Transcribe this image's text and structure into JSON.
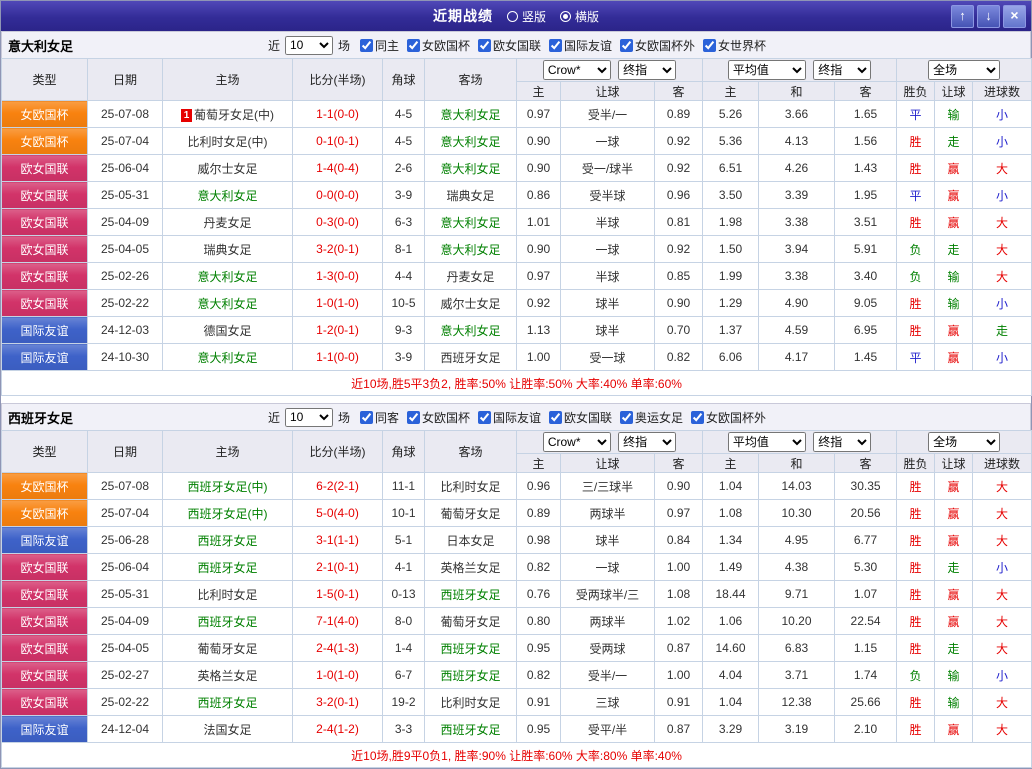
{
  "titlebar": {
    "title": "近期战绩",
    "radios": [
      {
        "label": "竖版",
        "checked": false
      },
      {
        "label": "横版",
        "checked": true
      }
    ],
    "up_icon": "↑",
    "down_icon": "↓",
    "close_icon": "×"
  },
  "filter_labels": {
    "near": "近",
    "games_suffix": "场"
  },
  "header": {
    "col_type": "类型",
    "col_date": "日期",
    "col_home": "主场",
    "col_score": "比分(半场)",
    "col_corner": "角球",
    "col_away": "客场",
    "bookmaker_select": "Crow*",
    "index_select_1": "终指",
    "avg_select": "平均值",
    "index_select_2": "终指",
    "scope_select": "全场",
    "sub_cols": [
      "主",
      "让球",
      "客",
      "主",
      "和",
      "客",
      "胜负",
      "让球",
      "进球数"
    ]
  },
  "colors": {
    "type_badges": {
      "女欧国杯": "#f8820f",
      "欧女国联": "#d23369",
      "国际友谊": "#3e62c9"
    },
    "team_focus": "#008000",
    "team_normal": "#333333",
    "score": "#e60000",
    "red_card_badge": "#e60000",
    "results": {
      "胜": "#e60000",
      "平": "#1f1fcc",
      "负": "#008000",
      "赢": "#e60000",
      "输": "#008000",
      "走": "#008000",
      "大": "#e60000",
      "小": "#1f1fcc"
    },
    "summary_text": "#e60000"
  },
  "sections": [
    {
      "team": "意大利女足",
      "filter": {
        "games_value": "10",
        "checkboxes": [
          {
            "label": "同主",
            "checked": true
          },
          {
            "label": "女欧国杯",
            "checked": true
          },
          {
            "label": "欧女国联",
            "checked": true
          },
          {
            "label": "国际友谊",
            "checked": true
          },
          {
            "label": "女欧国杯外",
            "checked": true
          },
          {
            "label": "女世界杯",
            "checked": true
          }
        ]
      },
      "rows": [
        {
          "type": "女欧国杯",
          "date": "25-07-08",
          "home": "葡萄牙女足(中)",
          "home_focus": false,
          "home_badge": "1",
          "score": "1-1(0-0)",
          "corner": "4-5",
          "away": "意大利女足",
          "away_focus": true,
          "odds": [
            "0.97",
            "受半/一",
            "0.89"
          ],
          "avg": [
            "5.26",
            "3.66",
            "1.65"
          ],
          "results": [
            "平",
            "输",
            "小"
          ]
        },
        {
          "type": "女欧国杯",
          "date": "25-07-04",
          "home": "比利时女足(中)",
          "home_focus": false,
          "score": "0-1(0-1)",
          "corner": "4-5",
          "away": "意大利女足",
          "away_focus": true,
          "odds": [
            "0.90",
            "一球",
            "0.92"
          ],
          "avg": [
            "5.36",
            "4.13",
            "1.56"
          ],
          "results": [
            "胜",
            "走",
            "小"
          ]
        },
        {
          "type": "欧女国联",
          "date": "25-06-04",
          "home": "威尔士女足",
          "home_focus": false,
          "score": "1-4(0-4)",
          "corner": "2-6",
          "away": "意大利女足",
          "away_focus": true,
          "odds": [
            "0.90",
            "受一/球半",
            "0.92"
          ],
          "avg": [
            "6.51",
            "4.26",
            "1.43"
          ],
          "results": [
            "胜",
            "赢",
            "大"
          ]
        },
        {
          "type": "欧女国联",
          "date": "25-05-31",
          "home": "意大利女足",
          "home_focus": true,
          "score": "0-0(0-0)",
          "corner": "3-9",
          "away": "瑞典女足",
          "away_focus": false,
          "odds": [
            "0.86",
            "受半球",
            "0.96"
          ],
          "avg": [
            "3.50",
            "3.39",
            "1.95"
          ],
          "results": [
            "平",
            "赢",
            "小"
          ]
        },
        {
          "type": "欧女国联",
          "date": "25-04-09",
          "home": "丹麦女足",
          "home_focus": false,
          "score": "0-3(0-0)",
          "corner": "6-3",
          "away": "意大利女足",
          "away_focus": true,
          "odds": [
            "1.01",
            "半球",
            "0.81"
          ],
          "avg": [
            "1.98",
            "3.38",
            "3.51"
          ],
          "results": [
            "胜",
            "赢",
            "大"
          ]
        },
        {
          "type": "欧女国联",
          "date": "25-04-05",
          "home": "瑞典女足",
          "home_focus": false,
          "score": "3-2(0-1)",
          "corner": "8-1",
          "away": "意大利女足",
          "away_focus": true,
          "odds": [
            "0.90",
            "一球",
            "0.92"
          ],
          "avg": [
            "1.50",
            "3.94",
            "5.91"
          ],
          "results": [
            "负",
            "走",
            "大"
          ]
        },
        {
          "type": "欧女国联",
          "date": "25-02-26",
          "home": "意大利女足",
          "home_focus": true,
          "score": "1-3(0-0)",
          "corner": "4-4",
          "away": "丹麦女足",
          "away_focus": false,
          "odds": [
            "0.97",
            "半球",
            "0.85"
          ],
          "avg": [
            "1.99",
            "3.38",
            "3.40"
          ],
          "results": [
            "负",
            "输",
            "大"
          ]
        },
        {
          "type": "欧女国联",
          "date": "25-02-22",
          "home": "意大利女足",
          "home_focus": true,
          "score": "1-0(1-0)",
          "corner": "10-5",
          "away": "威尔士女足",
          "away_focus": false,
          "odds": [
            "0.92",
            "球半",
            "0.90"
          ],
          "avg": [
            "1.29",
            "4.90",
            "9.05"
          ],
          "results": [
            "胜",
            "输",
            "小"
          ]
        },
        {
          "type": "国际友谊",
          "date": "24-12-03",
          "home": "德国女足",
          "home_focus": false,
          "score": "1-2(0-1)",
          "corner": "9-3",
          "away": "意大利女足",
          "away_focus": true,
          "odds": [
            "1.13",
            "球半",
            "0.70"
          ],
          "avg": [
            "1.37",
            "4.59",
            "6.95"
          ],
          "results": [
            "胜",
            "赢",
            "走"
          ]
        },
        {
          "type": "国际友谊",
          "date": "24-10-30",
          "home": "意大利女足",
          "home_focus": true,
          "score": "1-1(0-0)",
          "corner": "3-9",
          "away": "西班牙女足",
          "away_focus": false,
          "odds": [
            "1.00",
            "受一球",
            "0.82"
          ],
          "avg": [
            "6.06",
            "4.17",
            "1.45"
          ],
          "results": [
            "平",
            "赢",
            "小"
          ]
        }
      ],
      "summary": "近10场,胜5平3负2, 胜率:50% 让胜率:50% 大率:40% 单率:60%"
    },
    {
      "team": "西班牙女足",
      "filter": {
        "games_value": "10",
        "checkboxes": [
          {
            "label": "同客",
            "checked": true
          },
          {
            "label": "女欧国杯",
            "checked": true
          },
          {
            "label": "国际友谊",
            "checked": true
          },
          {
            "label": "欧女国联",
            "checked": true
          },
          {
            "label": "奥运女足",
            "checked": true
          },
          {
            "label": "女欧国杯外",
            "checked": true
          }
        ]
      },
      "rows": [
        {
          "type": "女欧国杯",
          "date": "25-07-08",
          "home": "西班牙女足(中)",
          "home_focus": true,
          "score": "6-2(2-1)",
          "corner": "11-1",
          "away": "比利时女足",
          "away_focus": false,
          "odds": [
            "0.96",
            "三/三球半",
            "0.90"
          ],
          "avg": [
            "1.04",
            "14.03",
            "30.35"
          ],
          "results": [
            "胜",
            "赢",
            "大"
          ]
        },
        {
          "type": "女欧国杯",
          "date": "25-07-04",
          "home": "西班牙女足(中)",
          "home_focus": true,
          "score": "5-0(4-0)",
          "corner": "10-1",
          "away": "葡萄牙女足",
          "away_focus": false,
          "odds": [
            "0.89",
            "两球半",
            "0.97"
          ],
          "avg": [
            "1.08",
            "10.30",
            "20.56"
          ],
          "results": [
            "胜",
            "赢",
            "大"
          ]
        },
        {
          "type": "国际友谊",
          "date": "25-06-28",
          "home": "西班牙女足",
          "home_focus": true,
          "score": "3-1(1-1)",
          "corner": "5-1",
          "away": "日本女足",
          "away_focus": false,
          "odds": [
            "0.98",
            "球半",
            "0.84"
          ],
          "avg": [
            "1.34",
            "4.95",
            "6.77"
          ],
          "results": [
            "胜",
            "赢",
            "大"
          ]
        },
        {
          "type": "欧女国联",
          "date": "25-06-04",
          "home": "西班牙女足",
          "home_focus": true,
          "score": "2-1(0-1)",
          "corner": "4-1",
          "away": "英格兰女足",
          "away_focus": false,
          "odds": [
            "0.82",
            "一球",
            "1.00"
          ],
          "avg": [
            "1.49",
            "4.38",
            "5.30"
          ],
          "results": [
            "胜",
            "走",
            "小"
          ]
        },
        {
          "type": "欧女国联",
          "date": "25-05-31",
          "home": "比利时女足",
          "home_focus": false,
          "score": "1-5(0-1)",
          "corner": "0-13",
          "away": "西班牙女足",
          "away_focus": true,
          "odds": [
            "0.76",
            "受两球半/三",
            "1.08"
          ],
          "avg": [
            "18.44",
            "9.71",
            "1.07"
          ],
          "results": [
            "胜",
            "赢",
            "大"
          ]
        },
        {
          "type": "欧女国联",
          "date": "25-04-09",
          "home": "西班牙女足",
          "home_focus": true,
          "score": "7-1(4-0)",
          "corner": "8-0",
          "away": "葡萄牙女足",
          "away_focus": false,
          "odds": [
            "0.80",
            "两球半",
            "1.02"
          ],
          "avg": [
            "1.06",
            "10.20",
            "22.54"
          ],
          "results": [
            "胜",
            "赢",
            "大"
          ]
        },
        {
          "type": "欧女国联",
          "date": "25-04-05",
          "home": "葡萄牙女足",
          "home_focus": false,
          "score": "2-4(1-3)",
          "corner": "1-4",
          "away": "西班牙女足",
          "away_focus": true,
          "odds": [
            "0.95",
            "受两球",
            "0.87"
          ],
          "avg": [
            "14.60",
            "6.83",
            "1.15"
          ],
          "results": [
            "胜",
            "走",
            "大"
          ]
        },
        {
          "type": "欧女国联",
          "date": "25-02-27",
          "home": "英格兰女足",
          "home_focus": false,
          "score": "1-0(1-0)",
          "corner": "6-7",
          "away": "西班牙女足",
          "away_focus": true,
          "odds": [
            "0.82",
            "受半/一",
            "1.00"
          ],
          "avg": [
            "4.04",
            "3.71",
            "1.74"
          ],
          "results": [
            "负",
            "输",
            "小"
          ]
        },
        {
          "type": "欧女国联",
          "date": "25-02-22",
          "home": "西班牙女足",
          "home_focus": true,
          "score": "3-2(0-1)",
          "corner": "19-2",
          "away": "比利时女足",
          "away_focus": false,
          "odds": [
            "0.91",
            "三球",
            "0.91"
          ],
          "avg": [
            "1.04",
            "12.38",
            "25.66"
          ],
          "results": [
            "胜",
            "输",
            "大"
          ]
        },
        {
          "type": "国际友谊",
          "date": "24-12-04",
          "home": "法国女足",
          "home_focus": false,
          "score": "2-4(1-2)",
          "corner": "3-3",
          "away": "西班牙女足",
          "away_focus": true,
          "odds": [
            "0.95",
            "受平/半",
            "0.87"
          ],
          "avg": [
            "3.29",
            "3.19",
            "2.10"
          ],
          "results": [
            "胜",
            "赢",
            "大"
          ]
        }
      ],
      "summary": "近10场,胜9平0负1, 胜率:90% 让胜率:60% 大率:80% 单率:40%"
    }
  ]
}
